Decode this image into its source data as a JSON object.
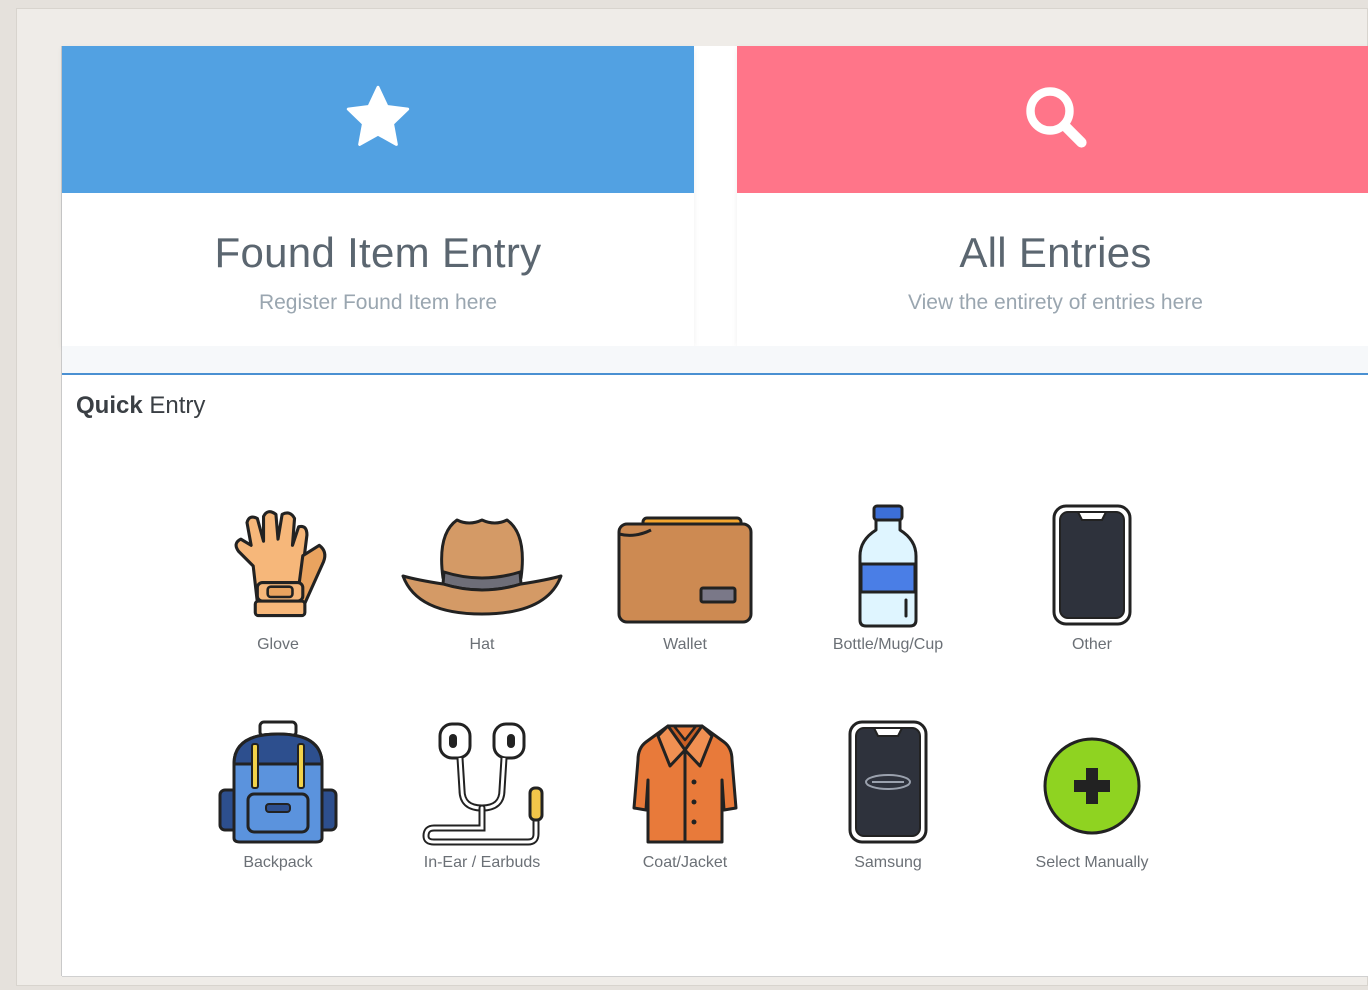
{
  "cards": {
    "found": {
      "title": "Found Item Entry",
      "subtitle": "Register Found Item here",
      "icon": "star-icon",
      "color": "#52a1e2"
    },
    "all": {
      "title": "All Entries",
      "subtitle": "View the entirety of entries here",
      "icon": "search-icon",
      "color": "#ff7589"
    }
  },
  "quick_entry": {
    "title_bold": "Quick",
    "title_rest": " Entry",
    "items": [
      {
        "label": "Glove",
        "icon": "glove-icon"
      },
      {
        "label": "Hat",
        "icon": "hat-icon"
      },
      {
        "label": "Wallet",
        "icon": "wallet-icon"
      },
      {
        "label": "Bottle/Mug/Cup",
        "icon": "bottle-icon"
      },
      {
        "label": "Other",
        "icon": "phone-icon"
      },
      {
        "label": "Backpack",
        "icon": "backpack-icon"
      },
      {
        "label": "In-Ear / Earbuds",
        "icon": "earbuds-icon"
      },
      {
        "label": "Coat/Jacket",
        "icon": "coat-icon"
      },
      {
        "label": "Samsung",
        "icon": "samsung-phone-icon"
      },
      {
        "label": "Select Manually",
        "icon": "plus-icon"
      }
    ]
  }
}
